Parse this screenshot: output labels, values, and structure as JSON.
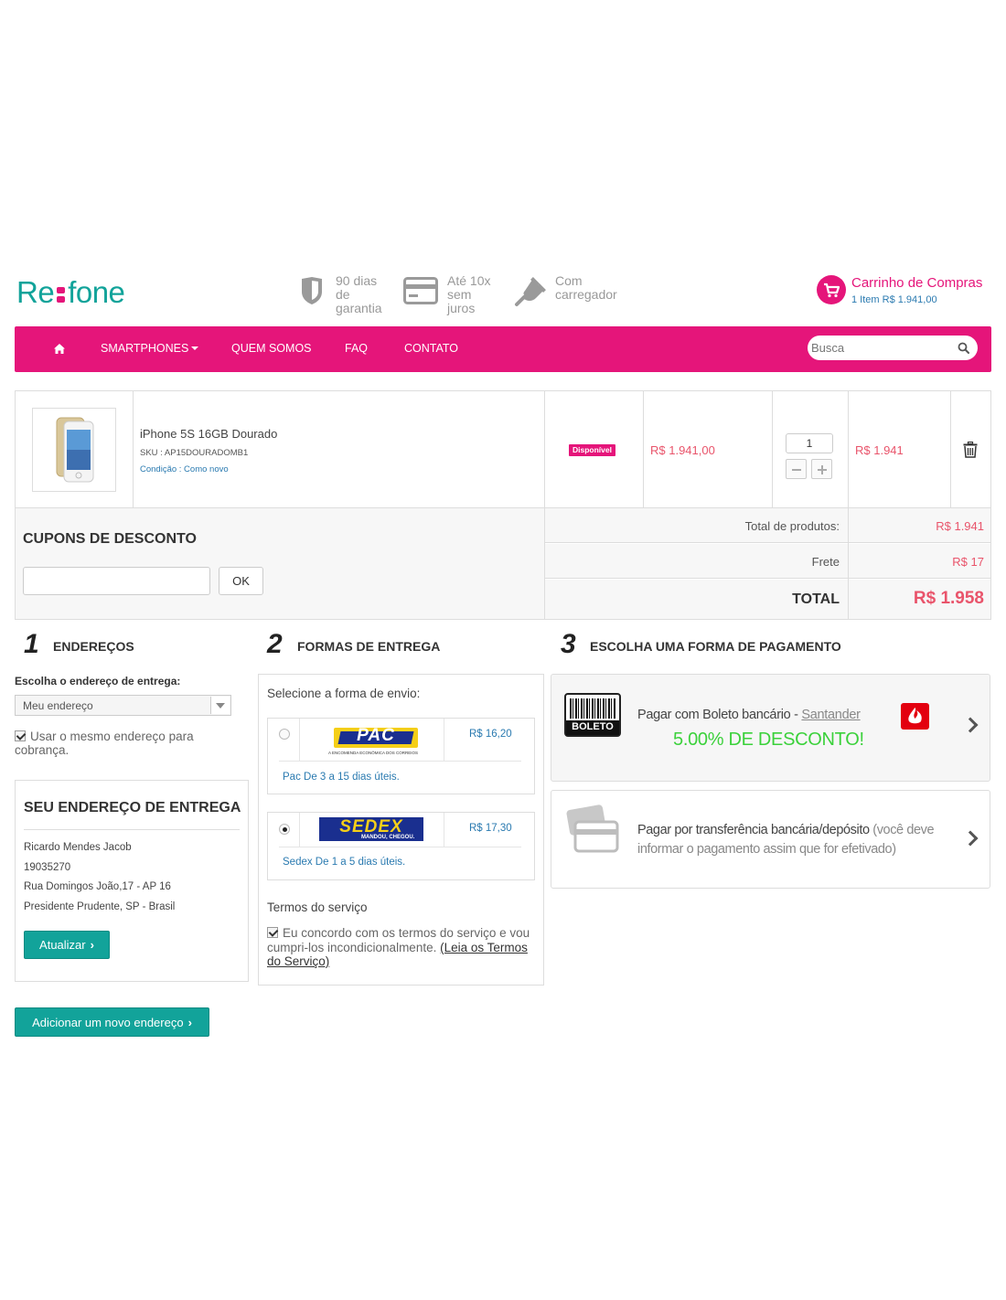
{
  "brand": {
    "logo_left": "Re",
    "logo_right": "fone",
    "pink": "#e5157a",
    "teal": "#12a39a"
  },
  "features": [
    {
      "icon": "shield-icon",
      "line1": "90 dias",
      "line2": "de",
      "line3": "garantia"
    },
    {
      "icon": "credit-card-icon",
      "line1": "Até 10x",
      "line2": "sem",
      "line3": "juros"
    },
    {
      "icon": "plug-icon",
      "line1": "Com",
      "line2": "carregador",
      "line3": ""
    }
  ],
  "cart": {
    "title": "Carrinho de Compras",
    "summary": "1 Item R$ 1.941,00"
  },
  "nav": {
    "items": [
      "SMARTPHONES",
      "QUEM SOMOS",
      "FAQ",
      "CONTATO"
    ],
    "search_placeholder": "Busca"
  },
  "product": {
    "name": "iPhone 5S 16GB Dourado",
    "sku": "SKU : AP15DOURADOMB1",
    "condition": "Condição : Como novo",
    "status": "Disponível",
    "unit_price": "R$ 1.941,00",
    "quantity": "1",
    "total": "R$ 1.941"
  },
  "coupon": {
    "title": "CUPONS DE DESCONTO",
    "button": "OK"
  },
  "totals": {
    "products_label": "Total de produtos:",
    "products_value": "R$ 1.941",
    "shipping_label": "Frete",
    "shipping_value": "R$ 17",
    "total_label": "TOTAL",
    "total_value": "R$ 1.958"
  },
  "address": {
    "step": "1",
    "title": "ENDEREÇOS",
    "choose_label": "Escolha o endereço de entrega:",
    "selected": "Meu endereço",
    "same_billing": "Usar o mesmo endereço para cobrança.",
    "box_title": "SEU ENDEREÇO DE ENTREGA",
    "lines": [
      "Ricardo Mendes Jacob",
      "19035270",
      "Rua Domingos João,17 - AP 16",
      "Presidente Prudente, SP - Brasil"
    ],
    "update_button": "Atualizar",
    "add_button": "Adicionar um novo endereço"
  },
  "delivery": {
    "step": "2",
    "title": "FORMAS DE ENTREGA",
    "prompt": "Selecione a forma de envio:",
    "options": [
      {
        "logo": "PAC",
        "logo_sub": "A ENCOMENDA ECONÔMICA DOS CORREIOS",
        "price": "R$ 16,20",
        "desc": "Pac De 3 a 15 dias úteis.",
        "selected": false
      },
      {
        "logo": "SEDEX",
        "logo_sub": "MANDOU, CHEGOU.",
        "price": "R$ 17,30",
        "desc": "Sedex De 1 a 5 dias úteis.",
        "selected": true
      }
    ],
    "terms_title": "Termos do serviço",
    "terms_text": "Eu concordo com os termos do serviço e vou cumpri-los incondicionalmente.",
    "terms_link": "(Leia os Termos do Serviço)"
  },
  "payment": {
    "step": "3",
    "title": "ESCOLHA UMA FORMA DE PAGAMENTO",
    "boleto_icon_label": "BOLETO",
    "boleto_text": "Pagar com Boleto bancário - ",
    "boleto_bank": "Santander",
    "boleto_discount": "5.00% DE DESCONTO!",
    "transfer_main": "Pagar por transferência bancária/depósito",
    "transfer_note": " (você deve informar o pagamento assim que for efetivado)"
  }
}
